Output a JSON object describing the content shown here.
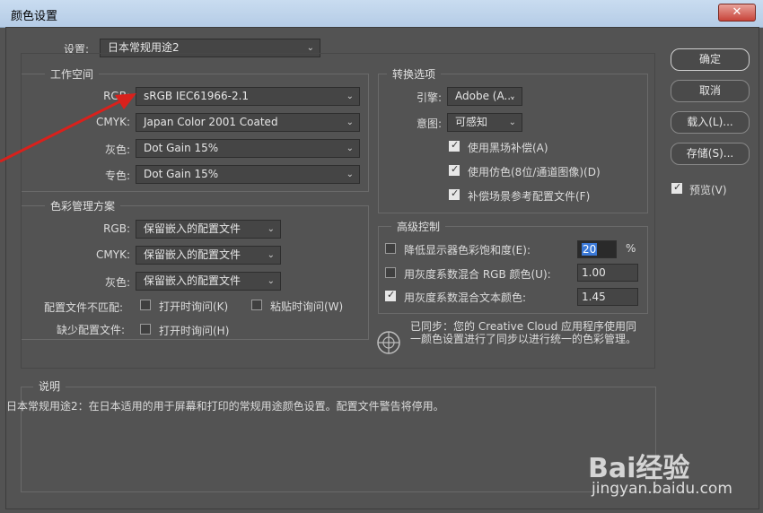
{
  "window": {
    "title": "颜色设置",
    "close_label": "✕"
  },
  "settings": {
    "label": "设置:",
    "value": "日本常规用途2"
  },
  "workspace": {
    "title": "工作空间",
    "rows": [
      {
        "label": "RGB:",
        "value": "sRGB IEC61966-2.1"
      },
      {
        "label": "CMYK:",
        "value": "Japan Color 2001 Coated"
      },
      {
        "label": "灰色:",
        "value": "Dot Gain 15%"
      },
      {
        "label": "专色:",
        "value": "Dot Gain 15%"
      }
    ]
  },
  "policies": {
    "title": "色彩管理方案",
    "rows": [
      {
        "label": "RGB:",
        "value": "保留嵌入的配置文件"
      },
      {
        "label": "CMYK:",
        "value": "保留嵌入的配置文件"
      },
      {
        "label": "灰色:",
        "value": "保留嵌入的配置文件"
      }
    ],
    "mismatch_label": "配置文件不匹配:",
    "mismatch_open": "打开时询问(K)",
    "mismatch_paste": "粘贴时询问(W)",
    "missing_label": "缺少配置文件:",
    "missing_open": "打开时询问(H)"
  },
  "conversion": {
    "title": "转换选项",
    "engine_label": "引擎:",
    "engine_value": "Adobe (A...",
    "intent_label": "意图:",
    "intent_value": "可感知",
    "bpc": "使用黑场补偿(A)",
    "dither": "使用仿色(8位/通道图像)(D)",
    "compensate": "补偿场景参考配置文件(F)"
  },
  "advanced": {
    "title": "高级控制",
    "desaturate_label": "降低显示器色彩饱和度(E):",
    "desaturate_value": "20",
    "percent": "%",
    "blend_rgb_label": "用灰度系数混合 RGB 颜色(U):",
    "blend_rgb_value": "1.00",
    "blend_text_label": "用灰度系数混合文本颜色:",
    "blend_text_value": "1.45"
  },
  "sync_text": "已同步：您的 Creative Cloud 应用程序使用同一颜色设置进行了同步以进行统一的色彩管理。",
  "description": {
    "title": "说明",
    "text": "日本常规用途2：在日本适用的用于屏幕和打印的常规用途颜色设置。配置文件警告将停用。"
  },
  "buttons": {
    "ok": "确定",
    "cancel": "取消",
    "load": "载入(L)...",
    "save": "存储(S)..."
  },
  "preview_label": "预览(V)",
  "watermark": {
    "brand": "Bai经验",
    "url": "jingyan.baidu.com"
  },
  "colors": {
    "bg": "#535353",
    "arrow": "#d9211c",
    "accent": "#3a78d6"
  }
}
